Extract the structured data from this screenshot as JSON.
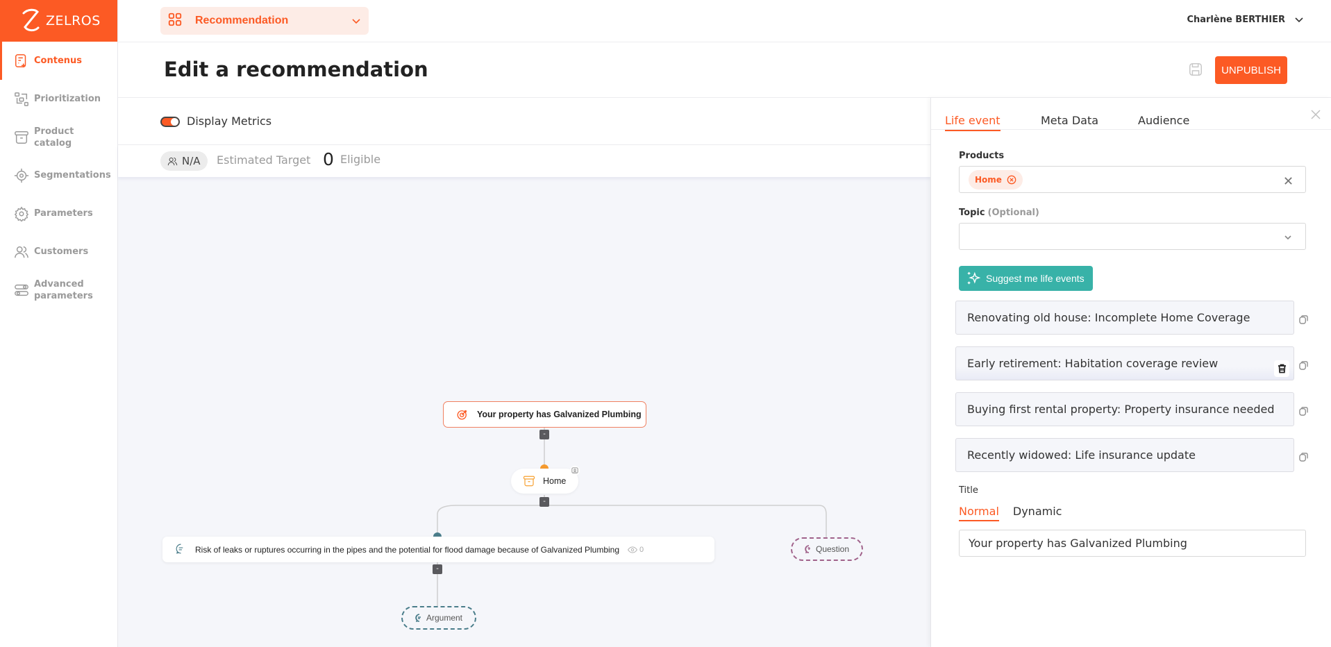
{
  "brand": {
    "name": "ZELROS",
    "accent": "#fc5a24"
  },
  "sidebar": {
    "items": [
      {
        "label": "Contenus",
        "icon": "content-add-icon",
        "active": true
      },
      {
        "label": "Prioritization",
        "icon": "prioritization-icon",
        "active": false
      },
      {
        "label": "Product catalog",
        "icon": "archive-box-icon",
        "active": false
      },
      {
        "label": "Segmentations",
        "icon": "target-icon",
        "active": false
      },
      {
        "label": "Parameters",
        "icon": "gear-icon",
        "active": false
      },
      {
        "label": "Customers",
        "icon": "users-icon",
        "active": false
      },
      {
        "label": "Advanced parameters",
        "icon": "toggles-icon",
        "active": false
      }
    ]
  },
  "topbar": {
    "module_select": "Recommendation",
    "user_name": "Charlène BERTHIER"
  },
  "header": {
    "title": "Edit a recommendation",
    "unpublish_label": "UNPUBLISH"
  },
  "metrics": {
    "toggle_label": "Display Metrics",
    "toggle_on": true,
    "estimated_target_value": "N/A",
    "estimated_target_label": "Estimated Target",
    "eligible_count": "0",
    "eligible_label": "Eligible"
  },
  "flow": {
    "main_node": "Your property has Galvanized Plumbing",
    "product_node": "Home",
    "argument_node": "Risk of leaks or ruptures occurring in the pipes and the potential for flood damage because of Galvanized Plumbing",
    "argument_views": "0",
    "question_placeholder": "Question",
    "argument_placeholder": "Argument",
    "collapse_label": "-"
  },
  "panel": {
    "tabs": [
      {
        "label": "Life event",
        "active": true
      },
      {
        "label": "Meta Data",
        "active": false
      },
      {
        "label": "Audience",
        "active": false
      }
    ],
    "products_label": "Products",
    "products_selected": [
      "Home"
    ],
    "topic_label": "Topic",
    "topic_optional": "(Optional)",
    "topic_value": "",
    "suggest_label": "Suggest me life events",
    "life_events": [
      "Renovating old house: Incomplete Home Coverage",
      "Early retirement: Habitation coverage review",
      "Buying first rental property: Property insurance needed",
      "Recently widowed: Life insurance update"
    ],
    "title_label": "Title",
    "title_tabs": [
      {
        "label": "Normal",
        "active": true
      },
      {
        "label": "Dynamic",
        "active": false
      }
    ],
    "title_value": "Your property has Galvanized Plumbing"
  }
}
